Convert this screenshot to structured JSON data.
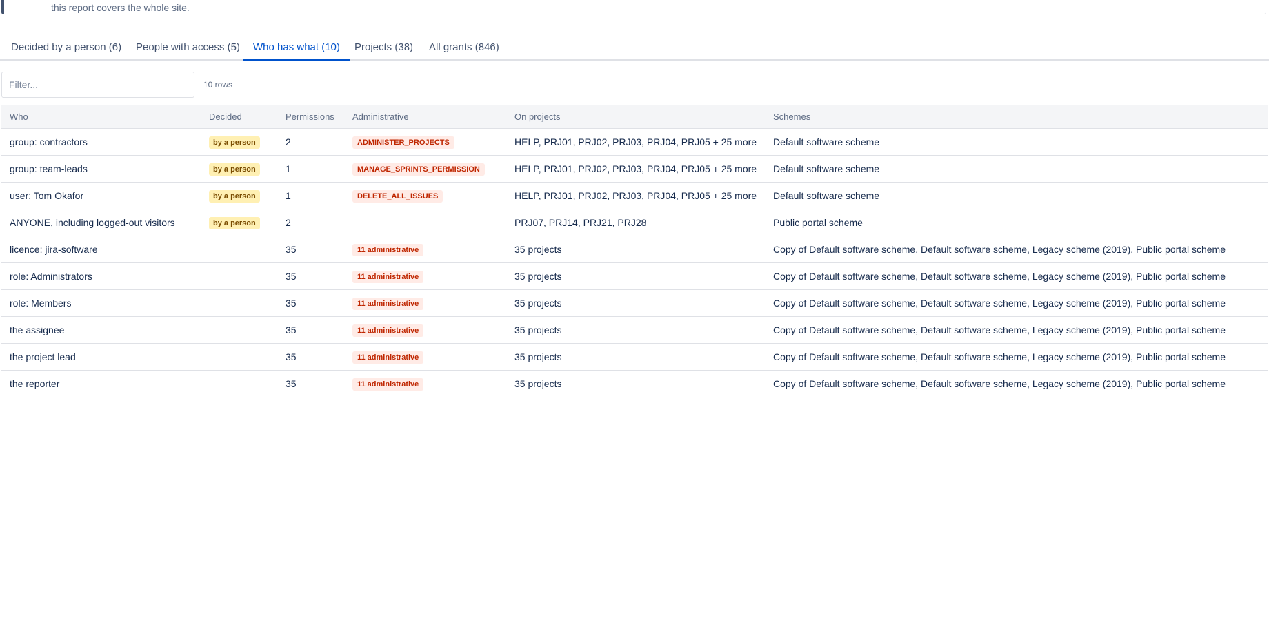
{
  "notice": {
    "text": "this report covers the whole site."
  },
  "tabs": [
    {
      "label": "Decided by a person (6)"
    },
    {
      "label": "People with access (5)"
    },
    {
      "label": "Who has what (10)"
    },
    {
      "label": "Projects (38)"
    },
    {
      "label": "All grants (846)"
    }
  ],
  "active_tab": "Who has what (10)",
  "filter": {
    "placeholder": "Filter...",
    "value": "",
    "row_count": "10 rows"
  },
  "table": {
    "headers": {
      "who": "Who",
      "decided": "Decided",
      "permissions": "Permissions",
      "administrative": "Administrative",
      "on_projects": "On projects",
      "schemes": "Schemes"
    },
    "rows": [
      {
        "who": "group: contractors",
        "decided": "by a person",
        "permissions": "2",
        "administrative": "ADMINISTER_PROJECTS",
        "on_projects": "HELP, PRJ01, PRJ02, PRJ03, PRJ04, PRJ05 + 25 more",
        "schemes": "Default software scheme"
      },
      {
        "who": "group: team-leads",
        "decided": "by a person",
        "permissions": "1",
        "administrative": "MANAGE_SPRINTS_PERMISSION",
        "on_projects": "HELP, PRJ01, PRJ02, PRJ03, PRJ04, PRJ05 + 25 more",
        "schemes": "Default software scheme"
      },
      {
        "who": "user: Tom Okafor",
        "decided": "by a person",
        "permissions": "1",
        "administrative": "DELETE_ALL_ISSUES",
        "on_projects": "HELP, PRJ01, PRJ02, PRJ03, PRJ04, PRJ05 + 25 more",
        "schemes": "Default software scheme"
      },
      {
        "who": "ANYONE, including logged-out visitors",
        "decided": "by a person",
        "permissions": "2",
        "administrative": "",
        "on_projects": "PRJ07, PRJ14, PRJ21, PRJ28",
        "schemes": "Public portal scheme"
      },
      {
        "who": "licence: jira-software",
        "decided": "",
        "permissions": "35",
        "administrative": "11 administrative",
        "on_projects": "35 projects",
        "schemes": "Copy of Default software scheme, Default software scheme, Legacy scheme (2019), Public portal scheme"
      },
      {
        "who": "role: Administrators",
        "decided": "",
        "permissions": "35",
        "administrative": "11 administrative",
        "on_projects": "35 projects",
        "schemes": "Copy of Default software scheme, Default software scheme, Legacy scheme (2019), Public portal scheme"
      },
      {
        "who": "role: Members",
        "decided": "",
        "permissions": "35",
        "administrative": "11 administrative",
        "on_projects": "35 projects",
        "schemes": "Copy of Default software scheme, Default software scheme, Legacy scheme (2019), Public portal scheme"
      },
      {
        "who": "the assignee",
        "decided": "",
        "permissions": "35",
        "administrative": "11 administrative",
        "on_projects": "35 projects",
        "schemes": "Copy of Default software scheme, Default software scheme, Legacy scheme (2019), Public portal scheme"
      },
      {
        "who": "the project lead",
        "decided": "",
        "permissions": "35",
        "administrative": "11 administrative",
        "on_projects": "35 projects",
        "schemes": "Copy of Default software scheme, Default software scheme, Legacy scheme (2019), Public portal scheme"
      },
      {
        "who": "the reporter",
        "decided": "",
        "permissions": "35",
        "administrative": "11 administrative",
        "on_projects": "35 projects",
        "schemes": "Copy of Default software scheme, Default software scheme, Legacy scheme (2019), Public portal scheme"
      }
    ]
  },
  "colors": {
    "accent": "#0052cc",
    "person_badge_bg": "#fff0b3",
    "person_badge_text": "#7a4c00",
    "admin_badge_bg": "#ffebe6",
    "admin_badge_text": "#bf2600"
  }
}
